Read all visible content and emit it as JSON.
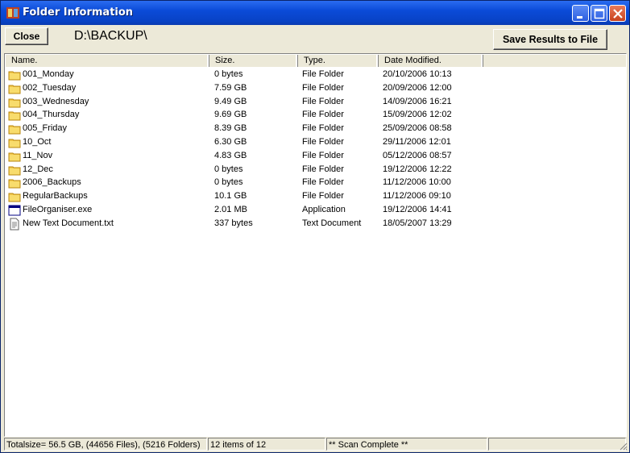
{
  "window": {
    "title": "Folder Information"
  },
  "toolbar": {
    "close_label": "Close",
    "path": "D:\\BACKUP\\",
    "save_label": "Save Results to File"
  },
  "columns": {
    "name": "Name.",
    "size": "Size.",
    "type": "Type.",
    "date": "Date Modified."
  },
  "rows": [
    {
      "icon": "folder-icon",
      "name": "001_Monday",
      "size": "0 bytes",
      "type": "File Folder",
      "date": "20/10/2006 10:13"
    },
    {
      "icon": "folder-icon",
      "name": "002_Tuesday",
      "size": "7.59 GB",
      "type": "File Folder",
      "date": "20/09/2006 12:00"
    },
    {
      "icon": "folder-icon",
      "name": "003_Wednesday",
      "size": "9.49 GB",
      "type": "File Folder",
      "date": "14/09/2006 16:21"
    },
    {
      "icon": "folder-icon",
      "name": "004_Thursday",
      "size": "9.69 GB",
      "type": "File Folder",
      "date": "15/09/2006 12:02"
    },
    {
      "icon": "folder-icon",
      "name": "005_Friday",
      "size": "8.39 GB",
      "type": "File Folder",
      "date": "25/09/2006 08:58"
    },
    {
      "icon": "folder-icon",
      "name": "10_Oct",
      "size": "6.30 GB",
      "type": "File Folder",
      "date": "29/11/2006 12:01"
    },
    {
      "icon": "folder-icon",
      "name": "11_Nov",
      "size": "4.83 GB",
      "type": "File Folder",
      "date": "05/12/2006 08:57"
    },
    {
      "icon": "folder-icon",
      "name": "12_Dec",
      "size": "0 bytes",
      "type": "File Folder",
      "date": "19/12/2006 12:22"
    },
    {
      "icon": "folder-icon",
      "name": "2006_Backups",
      "size": "0 bytes",
      "type": "File Folder",
      "date": "11/12/2006 10:00"
    },
    {
      "icon": "folder-icon",
      "name": "RegularBackups",
      "size": "10.1 GB",
      "type": "File Folder",
      "date": "11/12/2006 09:10"
    },
    {
      "icon": "application-icon",
      "name": "FileOrganiser.exe",
      "size": "2.01 MB",
      "type": "Application",
      "date": "19/12/2006 14:41"
    },
    {
      "icon": "text-document-icon",
      "name": "New Text Document.txt",
      "size": "337 bytes",
      "type": "Text Document",
      "date": "18/05/2007 13:29"
    }
  ],
  "status": {
    "totals": "Totalsize= 56.5 GB,  (44656 Files),   (5216 Folders)",
    "items": "12 items of 12",
    "scan": "** Scan Complete **",
    "extra": ""
  }
}
